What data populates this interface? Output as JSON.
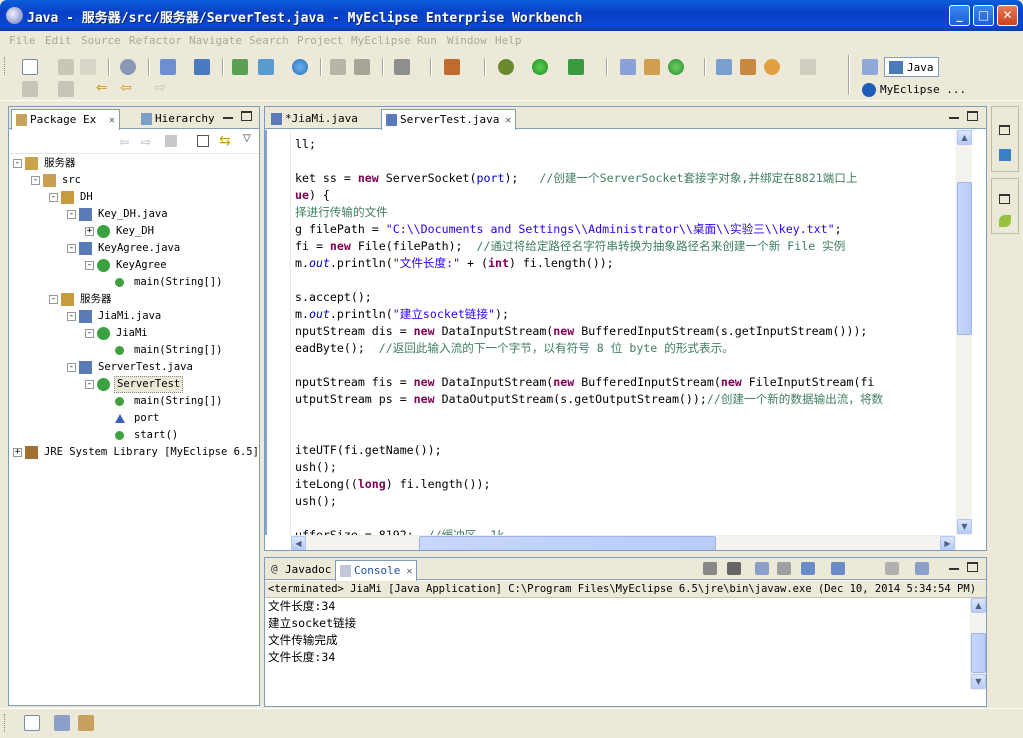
{
  "window": {
    "title": "Java - 服务器/src/服务器/ServerTest.java - MyEclipse Enterprise Workbench",
    "minimize": "_",
    "maximize": "□",
    "close": "✕"
  },
  "menu": [
    "File",
    "Edit",
    "Source",
    "Refactor",
    "Navigate",
    "Search",
    "Project",
    "MyEclipse",
    "Run",
    "Window",
    "Help"
  ],
  "perspectives": {
    "java": "Java",
    "myeclipse": "MyEclipse ..."
  },
  "package_explorer": {
    "tab_label": "Package Ex",
    "tab2_label": "Hierarchy",
    "tree": [
      {
        "label": "服务器",
        "depth": 0,
        "icon": "project-icon",
        "exp": "-"
      },
      {
        "label": "src",
        "depth": 1,
        "icon": "source-folder-icon",
        "exp": "-"
      },
      {
        "label": "DH",
        "depth": 2,
        "icon": "package-icon",
        "exp": "-"
      },
      {
        "label": "Key_DH.java",
        "depth": 3,
        "icon": "java-file-icon",
        "exp": "-"
      },
      {
        "label": "Key_DH",
        "depth": 4,
        "icon": "class-icon",
        "exp": "+"
      },
      {
        "label": "KeyAgree.java",
        "depth": 3,
        "icon": "java-file-icon",
        "exp": "-"
      },
      {
        "label": "KeyAgree",
        "depth": 4,
        "icon": "class-icon",
        "exp": "-"
      },
      {
        "label": "main(String[])",
        "depth": 5,
        "icon": "method-icon",
        "exp": ""
      },
      {
        "label": "服务器",
        "depth": 2,
        "icon": "package-icon",
        "exp": "-"
      },
      {
        "label": "JiaMi.java",
        "depth": 3,
        "icon": "java-file-icon",
        "exp": "-"
      },
      {
        "label": "JiaMi",
        "depth": 4,
        "icon": "class-icon",
        "exp": "-"
      },
      {
        "label": "main(String[])",
        "depth": 5,
        "icon": "method-icon",
        "exp": ""
      },
      {
        "label": "ServerTest.java",
        "depth": 3,
        "icon": "java-file-icon",
        "exp": "-"
      },
      {
        "label": "ServerTest",
        "depth": 4,
        "icon": "class-icon",
        "exp": "-",
        "selected": true
      },
      {
        "label": "main(String[])",
        "depth": 5,
        "icon": "method-icon",
        "exp": ""
      },
      {
        "label": "port",
        "depth": 5,
        "icon": "field-icon",
        "exp": ""
      },
      {
        "label": "start()",
        "depth": 5,
        "icon": "method-icon",
        "exp": ""
      },
      {
        "label": "JRE System Library [MyEclipse 6.5]",
        "depth": 0,
        "icon": "library-icon",
        "exp": "+"
      }
    ]
  },
  "editor": {
    "tabs": [
      {
        "label": "*JiaMi.java",
        "active": false
      },
      {
        "label": "ServerTest.java",
        "active": true
      }
    ],
    "lines": [
      [
        {
          "t": "ll;",
          "c": ""
        }
      ],
      [],
      [
        {
          "t": "ket ss = ",
          "c": ""
        },
        {
          "t": "new",
          "c": "kw"
        },
        {
          "t": " ServerSocket(",
          "c": ""
        },
        {
          "t": "port",
          "c": "fld"
        },
        {
          "t": ");   ",
          "c": ""
        },
        {
          "t": "//创建一个ServerSocket套接字对象,并绑定在8821端口上",
          "c": "com"
        }
      ],
      [
        {
          "t": "ue",
          "c": "kw"
        },
        {
          "t": ") {",
          "c": ""
        }
      ],
      [
        {
          "t": "择进行传输的文件",
          "c": "com"
        }
      ],
      [
        {
          "t": "g filePath = ",
          "c": ""
        },
        {
          "t": "\"C:\\\\Documents and Settings\\\\Administrator\\\\桌面\\\\实验三\\\\key.txt\"",
          "c": "str"
        },
        {
          "t": ";",
          "c": ""
        }
      ],
      [
        {
          "t": "fi = ",
          "c": ""
        },
        {
          "t": "new",
          "c": "kw"
        },
        {
          "t": " File(filePath);  ",
          "c": ""
        },
        {
          "t": "//通过将给定路径名字符串转换为抽象路径名来创建一个新 File 实例",
          "c": "com"
        }
      ],
      [
        {
          "t": "m.",
          "c": ""
        },
        {
          "t": "out",
          "c": "fld it"
        },
        {
          "t": ".println(",
          "c": ""
        },
        {
          "t": "\"文件长度:\"",
          "c": "str"
        },
        {
          "t": " + (",
          "c": ""
        },
        {
          "t": "int",
          "c": "kw"
        },
        {
          "t": ") fi.length());",
          "c": ""
        }
      ],
      [],
      [
        {
          "t": "s.accept();",
          "c": ""
        }
      ],
      [
        {
          "t": "m.",
          "c": ""
        },
        {
          "t": "out",
          "c": "fld it"
        },
        {
          "t": ".println(",
          "c": ""
        },
        {
          "t": "\"建立socket链接\"",
          "c": "str"
        },
        {
          "t": ");",
          "c": ""
        }
      ],
      [
        {
          "t": "nputStream dis = ",
          "c": ""
        },
        {
          "t": "new",
          "c": "kw"
        },
        {
          "t": " DataInputStream(",
          "c": ""
        },
        {
          "t": "new",
          "c": "kw"
        },
        {
          "t": " BufferedInputStream(s.getInputStream()));",
          "c": ""
        }
      ],
      [
        {
          "t": "eadByte();  ",
          "c": ""
        },
        {
          "t": "//返回此输入流的下一个字节，以有符号 8 位 byte 的形式表示。",
          "c": "com"
        }
      ],
      [],
      [
        {
          "t": "nputStream fis = ",
          "c": ""
        },
        {
          "t": "new",
          "c": "kw"
        },
        {
          "t": " DataInputStream(",
          "c": ""
        },
        {
          "t": "new",
          "c": "kw"
        },
        {
          "t": " BufferedInputStream(",
          "c": ""
        },
        {
          "t": "new",
          "c": "kw"
        },
        {
          "t": " FileInputStream(fi",
          "c": ""
        }
      ],
      [
        {
          "t": "utputStream ps = ",
          "c": ""
        },
        {
          "t": "new",
          "c": "kw"
        },
        {
          "t": " DataOutputStream(s.getOutputStream());",
          "c": ""
        },
        {
          "t": "//创建一个新的数据输出流，将数",
          "c": "com"
        }
      ],
      [],
      [],
      [
        {
          "t": "iteUTF(fi.getName());",
          "c": ""
        }
      ],
      [
        {
          "t": "ush();",
          "c": ""
        }
      ],
      [
        {
          "t": "iteLong((",
          "c": ""
        },
        {
          "t": "long",
          "c": "kw"
        },
        {
          "t": ") fi.length());",
          "c": ""
        }
      ],
      [
        {
          "t": "ush();",
          "c": ""
        }
      ],
      [],
      [
        {
          "t": "ufferSize = 8192;  ",
          "c": ""
        },
        {
          "t": "//缓冲区, 1k",
          "c": "com"
        }
      ]
    ]
  },
  "console": {
    "tabs": [
      {
        "label": "Javadoc",
        "active": false
      },
      {
        "label": "Console",
        "active": true
      }
    ],
    "header": "<terminated> JiaMi [Java Application] C:\\Program Files\\MyEclipse 6.5\\jre\\bin\\javaw.exe (Dec 10, 2014 5:34:54 PM)",
    "lines": [
      "文件长度:34",
      "建立socket链接",
      "文件传输完成",
      "文件长度:34"
    ]
  }
}
